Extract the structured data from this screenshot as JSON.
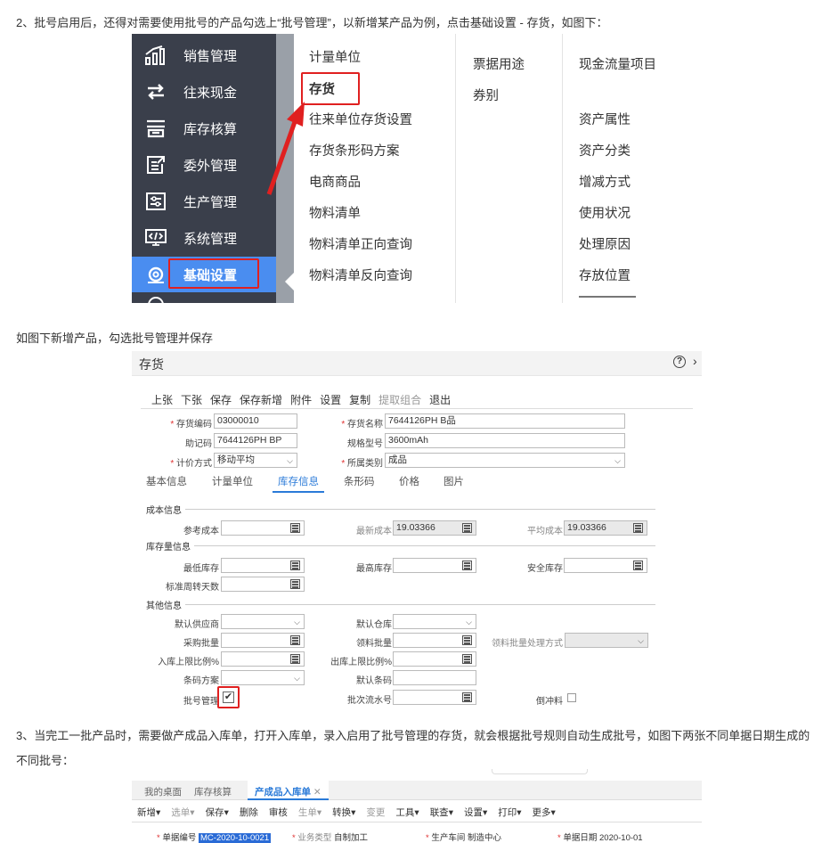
{
  "paragraphs": {
    "p1": "2、批号启用后，还得对需要使用批号的产品勾选上“批号管理”，以新增某产品为例，点击基础设置 - 存货，如图下：",
    "p2": "如图下新增产品，勾选批号管理并保存",
    "p3": "3、当完工一批产品时，需要做产成品入库单，打开入库单，录入启用了批号管理的存货，就会根据批号规则自动生成批号，如图下两张不同单据日期生成的不同批号："
  },
  "menu": {
    "items": [
      "销售管理",
      "往来现金",
      "库存核算",
      "委外管理",
      "生产管理",
      "系统管理",
      "基础设置"
    ],
    "col1": [
      "计量单位",
      "存货",
      "往来单位存货设置",
      "存货条形码方案",
      "电商商品",
      "物料清单",
      "物料清单正向查询",
      "物料清单反向查询"
    ],
    "col2": [
      "票据用途",
      "券别"
    ],
    "col3": [
      "现金流量项目",
      "资产属性",
      "资产分类",
      "增减方式",
      "使用状况",
      "处理原因",
      "存放位置"
    ]
  },
  "form": {
    "title": "存货",
    "toolbar": [
      "上张",
      "下张",
      "保存",
      "保存新增",
      "附件",
      "设置",
      "复制",
      "提取组合",
      "退出"
    ],
    "code_label": "存货编码",
    "code": "03000010",
    "name_label": "存货名称",
    "name": "7644126PH  B品",
    "mnemonic_label": "助记码",
    "mnemonic": "7644126PH  BP",
    "spec_label": "规格型号",
    "spec": "3600mAh",
    "pricing_label": "计价方式",
    "pricing": "移动平均",
    "category_label": "所属类别",
    "category": "成品",
    "tabs": [
      "基本信息",
      "计量单位",
      "库存信息",
      "条形码",
      "价格",
      "图片"
    ],
    "sec_cost": "成本信息",
    "ref_cost": "参考成本",
    "latest_cost_label": "最新成本",
    "latest_cost": "19.03366",
    "avg_cost_label": "平均成本",
    "avg_cost": "19.03366",
    "sec_stock": "库存量信息",
    "min_stock": "最低库存",
    "max_stock": "最高库存",
    "safe_stock": "安全库存",
    "turnover": "标准周转天数",
    "sec_other": "其他信息",
    "supplier": "默认供应商",
    "warehouse": "默认仓库",
    "purchase_batch": "采购批量",
    "pick_batch": "领料批量",
    "pick_batch_mode": "领料批量处理方式",
    "in_limit": "入库上限比例%",
    "out_limit": "出库上限比例%",
    "barcode_scheme": "条码方案",
    "default_barcode": "默认条码",
    "batch_mgmt": "批号管理",
    "batch_serial": "批次流水号",
    "backflush": "倒冲料"
  },
  "doc": {
    "tabs": [
      "我的桌面",
      "库存核算",
      "产成品入库单"
    ],
    "toolbar": [
      "新增",
      "选单",
      "保存",
      "删除",
      "审核",
      "生单",
      "转换",
      "变更",
      "工具",
      "联查",
      "设置",
      "打印",
      "更多"
    ],
    "no_label": "单据编号",
    "no": "MC-2020-10-0021",
    "biz_label": "业务类型",
    "biz": "自制加工",
    "ws_label": "生产车间",
    "ws": "制造中心",
    "date_label": "单据日期",
    "date": "2020-10-01"
  }
}
